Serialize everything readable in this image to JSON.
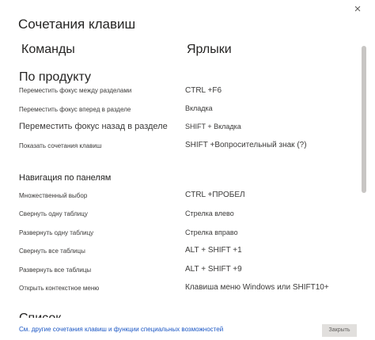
{
  "dialog": {
    "title": "Сочетания клавиш",
    "close_icon": "×"
  },
  "columns": {
    "commands": "Команды",
    "shortcuts": "Ярлыки"
  },
  "sections": [
    {
      "title": "По продукту",
      "rows": [
        {
          "command": "Переместить фокус между разделами",
          "shortcut": "CTRL +F6"
        },
        {
          "command": "Переместить фокус вперед в разделе",
          "shortcut": "Вкладка"
        },
        {
          "command": "Переместить фокус назад в разделе",
          "shortcut": "SHIFT + Вкладка"
        },
        {
          "command": "Показать сочетания клавиш",
          "shortcut": "SHIFT +Вопросительный знак (?)"
        }
      ]
    },
    {
      "title": "Навигация по панелям",
      "rows": [
        {
          "command": "Множественный выбор",
          "shortcut": "CTRL +ПРОБЕЛ"
        },
        {
          "command": "Свернуть одну таблицу",
          "shortcut": "Стрелка влево"
        },
        {
          "command": "Развернуть одну таблицу",
          "shortcut": "Стрелка вправо"
        },
        {
          "command": "Свернуть все таблицы",
          "shortcut": "ALT + SHIFT +1"
        },
        {
          "command": "Развернуть все таблицы",
          "shortcut": "ALT + SHIFT +9"
        },
        {
          "command": "Открыть контекстное меню",
          "shortcut": "Клавиша меню Windows или SHIFT10+"
        }
      ]
    }
  ],
  "partial_heading": "Список",
  "footer": {
    "link": "См. другие сочетания клавиш и функции специальных возможностей",
    "close_label": "Закрыть"
  }
}
